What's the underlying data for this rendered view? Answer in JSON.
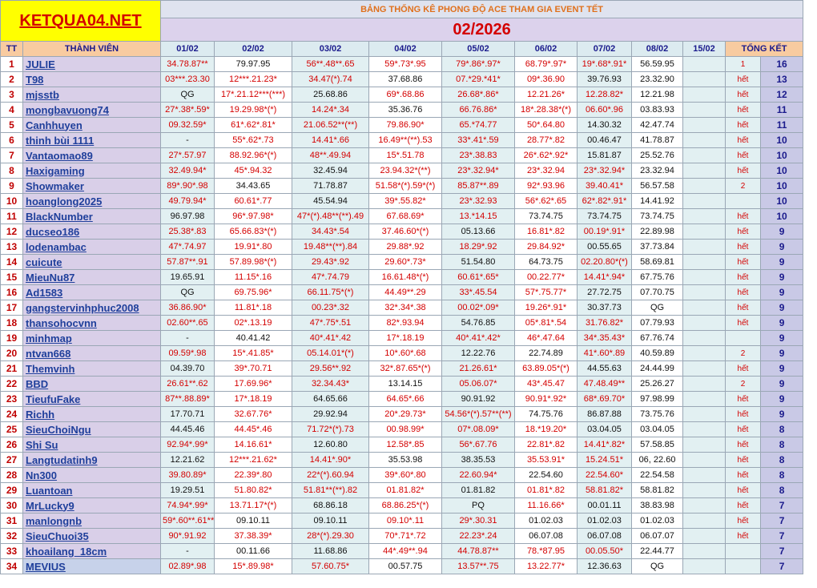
{
  "site_logo": "KETQUA04.NET",
  "banner_title": "BẢNG THỐNG KÊ PHONG ĐỘ ACE THAM GIA EVENT TẾT",
  "month": "02/2026",
  "headers": {
    "tt": "TT",
    "member": "THÀNH VIÊN",
    "dates": [
      "01/02",
      "02/02",
      "03/02",
      "04/02",
      "05/02",
      "06/02",
      "07/02",
      "08/02",
      "15/02"
    ],
    "total": "TỔNG KẾT"
  },
  "colors": {
    "accent_red": "#d40000",
    "name_blue": "#1f3f9b",
    "logo_bg": "#ffff00"
  },
  "rows": [
    {
      "tt": "1",
      "name": "JULIE",
      "vals": [
        "34.78.87**",
        "79.97.95",
        "56**.48**.65",
        "59*.73*.95",
        "79*.86*.97*",
        "68.79*.97*",
        "19*.68*.91*",
        "56.59.95",
        ""
      ],
      "note": "1",
      "total": "16"
    },
    {
      "tt": "2",
      "name": "T98",
      "vals": [
        "03***.23.30",
        "12***.21.23*",
        "34.47(*).74",
        "37.68.86",
        "07.*29.*41*",
        "09*.36.90",
        "39.76.93",
        "23.32.90",
        ""
      ],
      "note": "hết",
      "total": "13"
    },
    {
      "tt": "3",
      "name": "mjsstb",
      "vals": [
        "QG",
        "17*.21.12***(***)",
        "25.68.86",
        "69*.68.86",
        "26.68*.86*",
        "12.21.26*",
        "12.28.82*",
        "12.21.98",
        ""
      ],
      "note": "hết",
      "total": "12"
    },
    {
      "tt": "4",
      "name": "mongbavuong74",
      "vals": [
        "27*.38*.59*",
        "19.29.98*(*)",
        "14.24*.34",
        "35.36.76",
        "66.76.86*",
        "18*.28.38*(*)",
        "06.60*.96",
        "03.83.93",
        ""
      ],
      "note": "hết",
      "total": "11"
    },
    {
      "tt": "5",
      "name": "Canhhuyen",
      "vals": [
        "09.32.59*",
        "61*.62*.81*",
        "21.06.52**(**)",
        "79.86.90*",
        "65.*74.77",
        "50*.64.80",
        "14.30.32",
        "42.47.74",
        ""
      ],
      "note": "hết",
      "total": "11"
    },
    {
      "tt": "6",
      "name": "thinh bùi 1111",
      "vals": [
        "-",
        "55*.62*.73",
        "14.41*.66",
        "16.49**(**).53",
        "33*.41*.59",
        "28.77*.82",
        "00.46.47",
        "41.78.87",
        ""
      ],
      "note": "hết",
      "total": "10"
    },
    {
      "tt": "7",
      "name": "Vantaomao89",
      "vals": [
        "27*.57.97",
        "88.92.96*(*)",
        "48**.49.94",
        "15*.51.78",
        "23*.38.83",
        "26*.62*.92*",
        "15.81.87",
        "25.52.76",
        ""
      ],
      "note": "hết",
      "total": "10"
    },
    {
      "tt": "8",
      "name": "Haxigaming",
      "vals": [
        "32.49.94*",
        "45*.94.32",
        "32.45.94",
        "23.94.32*(**)",
        "23*.32.94*",
        "23*.32.94",
        "23*.32.94*",
        "23.32.94",
        ""
      ],
      "note": "hết",
      "total": "10"
    },
    {
      "tt": "9",
      "name": "Showmaker",
      "vals": [
        "89*.90*.98",
        "34.43.65",
        "71.78.87",
        "51.58*(*).59*(*)",
        "85.87**.89",
        "92*.93.96",
        "39.40.41*",
        "56.57.58",
        ""
      ],
      "note": "2",
      "total": "10"
    },
    {
      "tt": "10",
      "name": "hoanglong2025",
      "vals": [
        "49.79.94*",
        "60.61*.77",
        "45.54.94",
        "39*.55.82*",
        "23*.32.93",
        "56*.62*.65",
        "62*.82*.91*",
        "14.41.92",
        ""
      ],
      "note": "",
      "total": "10"
    },
    {
      "tt": "11",
      "name": "BlackNumber",
      "vals": [
        "96.97.98",
        "96*.97.98*",
        "47*(*).48**(**).49",
        "67.68.69*",
        "13.*14.15",
        "73.74.75",
        "73.74.75",
        "73.74.75",
        ""
      ],
      "note": "hết",
      "total": "10"
    },
    {
      "tt": "12",
      "name": "ducseo186",
      "vals": [
        "25.38*.83",
        "65.66.83*(*)",
        "34.43*.54",
        "37.46.60*(*)",
        "05.13.66",
        "16.81*.82",
        "00.19*.91*",
        "22.89.98",
        ""
      ],
      "note": "hết",
      "total": "9"
    },
    {
      "tt": "13",
      "name": "lodenambac",
      "vals": [
        "47*.74.97",
        "19.91*.80",
        "19.48**(**).84",
        "29.88*.92",
        "18.29*.92",
        "29.84.92*",
        "00.55.65",
        "37.73.84",
        ""
      ],
      "note": "hết",
      "total": "9"
    },
    {
      "tt": "14",
      "name": "cuicute",
      "vals": [
        "57.87**.91",
        "57.89.98*(*)",
        "29.43*.92",
        "29.60*.73*",
        "51.54.80",
        "64.73.75",
        "02.20.80*(*)",
        "58.69.81",
        ""
      ],
      "note": "hết",
      "total": "9"
    },
    {
      "tt": "15",
      "name": "MieuNu87",
      "vals": [
        "19.65.91",
        "11.15*.16",
        "47*.74.79",
        "16.61.48*(*)",
        "60.61*.65*",
        "00.22.77*",
        "14.41*.94*",
        "67.75.76",
        ""
      ],
      "note": "hết",
      "total": "9"
    },
    {
      "tt": "16",
      "name": "Ad1583",
      "vals": [
        "QG",
        "69.75.96*",
        "66.11.75*(*)",
        "44.49**.29",
        "33*.45.54",
        "57*.75.77*",
        "27.72.75",
        "07.70.75",
        ""
      ],
      "note": "hết",
      "total": "9"
    },
    {
      "tt": "17",
      "name": "gangstervinhphuc2008",
      "vals": [
        "36.86.90*",
        "11.81*.18",
        "00.23*.32",
        "32*.34*.38",
        "00.02*.09*",
        "19.26*.91*",
        "30.37.73",
        "QG",
        ""
      ],
      "note": "hết",
      "total": "9"
    },
    {
      "tt": "18",
      "name": "thansohocvnn",
      "vals": [
        "02.60**.65",
        "02*.13.19",
        "47*.75*.51",
        "82*.93.94",
        "54.76.85",
        "05*.81*.54",
        "31.76.82*",
        "07.79.93",
        ""
      ],
      "note": "hết",
      "total": "9"
    },
    {
      "tt": "19",
      "name": "minhmap",
      "vals": [
        "-",
        "40.41.42",
        "40*.41*.42",
        "17*.18.19",
        "40*.41*.42*",
        "46*.47.64",
        "34*.35.43*",
        "67.76.74",
        ""
      ],
      "note": "",
      "total": "9"
    },
    {
      "tt": "20",
      "name": "ntvan668",
      "vals": [
        "09.59*.98",
        "15*.41.85*",
        "05.14.01*(*)",
        "10*.60*.68",
        "12.22.76",
        "22.74.89",
        "41*.60*.89",
        "40.59.89",
        ""
      ],
      "note": "2",
      "total": "9"
    },
    {
      "tt": "21",
      "name": "Themvinh",
      "vals": [
        "04.39.70",
        "39*.70.71",
        "29.56**.92",
        "32*.87.65*(*)",
        "21.26.61*",
        "63.89.05*(*)",
        "44.55.63",
        "24.44.99",
        ""
      ],
      "note": "hết",
      "total": "9"
    },
    {
      "tt": "22",
      "name": "BBD",
      "vals": [
        "26.61**.62",
        "17.69.96*",
        "32.34.43*",
        "13.14.15",
        "05.06.07*",
        "43*.45.47",
        "47.48.49**",
        "25.26.27",
        ""
      ],
      "note": "2",
      "total": "9"
    },
    {
      "tt": "23",
      "name": "TieufuFake",
      "vals": [
        "87**.88.89*",
        "17*.18.19",
        "64.65.66",
        "64.65*.66",
        "90.91.92",
        "90.91*.92*",
        "68*.69.70*",
        "97.98.99",
        ""
      ],
      "note": "hết",
      "total": "9"
    },
    {
      "tt": "24",
      "name": "Richh",
      "vals": [
        "17.70.71",
        "32.67.76*",
        "29.92.94",
        "20*.29.73*",
        "54.56*(*).57**(**)",
        "74.75.76",
        "86.87.88",
        "73.75.76",
        ""
      ],
      "note": "hết",
      "total": "9"
    },
    {
      "tt": "25",
      "name": "SieuChoiNgu",
      "vals": [
        "44.45.46",
        "44.45*.46",
        "71.72*(*).73",
        "00.98.99*",
        "07*.08.09*",
        "18.*19.20*",
        "03.04.05",
        "03.04.05",
        ""
      ],
      "note": "hết",
      "total": "8"
    },
    {
      "tt": "26",
      "name": "Shi Su",
      "vals": [
        "92.94*.99*",
        "14.16.61*",
        "12.60.80",
        "12.58*.85",
        "56*.67.76",
        "22.81*.82",
        "14.41*.82*",
        "57.58.85",
        ""
      ],
      "note": "hết",
      "total": "8"
    },
    {
      "tt": "27",
      "name": "Langtudatinh9",
      "vals": [
        "12.21.62",
        "12***.21.62*",
        "14.41*.90*",
        "35.53.98",
        "38.35.53",
        "35.53.91*",
        "15.24.51*",
        "06, 22.60",
        ""
      ],
      "note": "hết",
      "total": "8"
    },
    {
      "tt": "28",
      "name": "Nn300",
      "vals": [
        "39.80.89*",
        "22.39*.80",
        "22*(*).60.94",
        "39*.60*.80",
        "22.60.94*",
        "22.54.60",
        "22.54.60*",
        "22.54.58",
        ""
      ],
      "note": "hết",
      "total": "8"
    },
    {
      "tt": "29",
      "name": "Luantoan",
      "vals": [
        "19.29.51",
        "51.80.82*",
        "51.81**(**).82",
        "01.81.82*",
        "01.81.82",
        "01.81*.82",
        "58.81.82*",
        "58.81.82",
        ""
      ],
      "note": "hết",
      "total": "8"
    },
    {
      "tt": "30",
      "name": "MrLucky9",
      "vals": [
        "74.94*.99*",
        "13.71.17*(*)",
        "68.86.18",
        "68.86.25*(*)",
        "PQ",
        "11.16.66*",
        "00.01.11",
        "38.83.98",
        ""
      ],
      "note": "hết",
      "total": "7"
    },
    {
      "tt": "31",
      "name": "manlongnb",
      "vals": [
        "59*.60**.61**",
        "09.10.11",
        "09.10.11",
        "09.10*.11",
        "29*.30.31",
        "01.02.03",
        "01.02.03",
        "01.02.03",
        ""
      ],
      "note": "hết",
      "total": "7"
    },
    {
      "tt": "32",
      "name": "SieuChuoi35",
      "vals": [
        "90*.91.92",
        "37.38.39*",
        "28*(*).29.30",
        "70*.71*.72",
        "22.23*.24",
        "06.07.08",
        "06.07.08",
        "06.07.07",
        ""
      ],
      "note": "hết",
      "total": "7"
    },
    {
      "tt": "33",
      "name": "khoailang_18cm",
      "vals": [
        "-",
        "00.11.66",
        "11.68.86",
        "44*.49**.94",
        "44.78.87**",
        "78.*87.95",
        "00.05.50*",
        "22.44.77",
        ""
      ],
      "note": "",
      "total": "7"
    },
    {
      "tt": "34",
      "name": "MEVIUS",
      "vals": [
        "02.89*.98",
        "15*.89.98*",
        "57.60.75*",
        "00.57.75",
        "13.57**.75",
        "13.22.77*",
        "12.36.63",
        "QG",
        ""
      ],
      "note": "",
      "total": "7"
    }
  ]
}
